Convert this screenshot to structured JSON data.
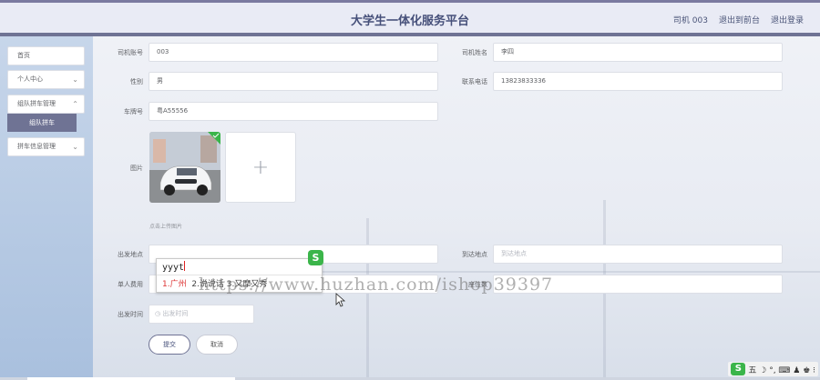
{
  "header": {
    "title": "大学生一体化服务平台",
    "user": "司机 003",
    "to_front": "退出到前台",
    "logout": "退出登录"
  },
  "sidebar": {
    "items": [
      {
        "label": "首页"
      },
      {
        "label": "个人中心"
      },
      {
        "label": "组队拼车管理"
      },
      {
        "label": "拼车信息管理"
      }
    ],
    "active_sub": "组队拼车"
  },
  "form": {
    "driver_no_label": "司机账号",
    "driver_no_value": "003",
    "driver_name_label": "司机姓名",
    "driver_name_value": "李四",
    "gender_label": "性别",
    "gender_value": "男",
    "phone_label": "联系电话",
    "phone_value": "13823833336",
    "plate_label": "车牌号",
    "plate_value": "粤A55556",
    "image_label": "图片",
    "upload_tip": "点击上传图片",
    "upload_plus": "+",
    "depart_label": "出发地点",
    "depart_value": "",
    "arrive_label": "到达地点",
    "arrive_placeholder": "到达地点",
    "fee_label": "单人费用",
    "fee_value": "",
    "seats_label": "座位数",
    "seats_value": "",
    "time_label": "出发时间",
    "time_placeholder": "出发时间",
    "submit": "提交",
    "cancel": "取消"
  },
  "ime": {
    "composition": "yyyt",
    "candidate_1": "1.广州",
    "candidate_rest": "2.说说话 3.又摩又秀",
    "logo": "S"
  },
  "watermark": "https://www.huzhan.com/ishop39397",
  "tray": {
    "logo": "S",
    "glyphs": "五 ☽ °, ⌨ ♟ ♚ ⁝"
  }
}
